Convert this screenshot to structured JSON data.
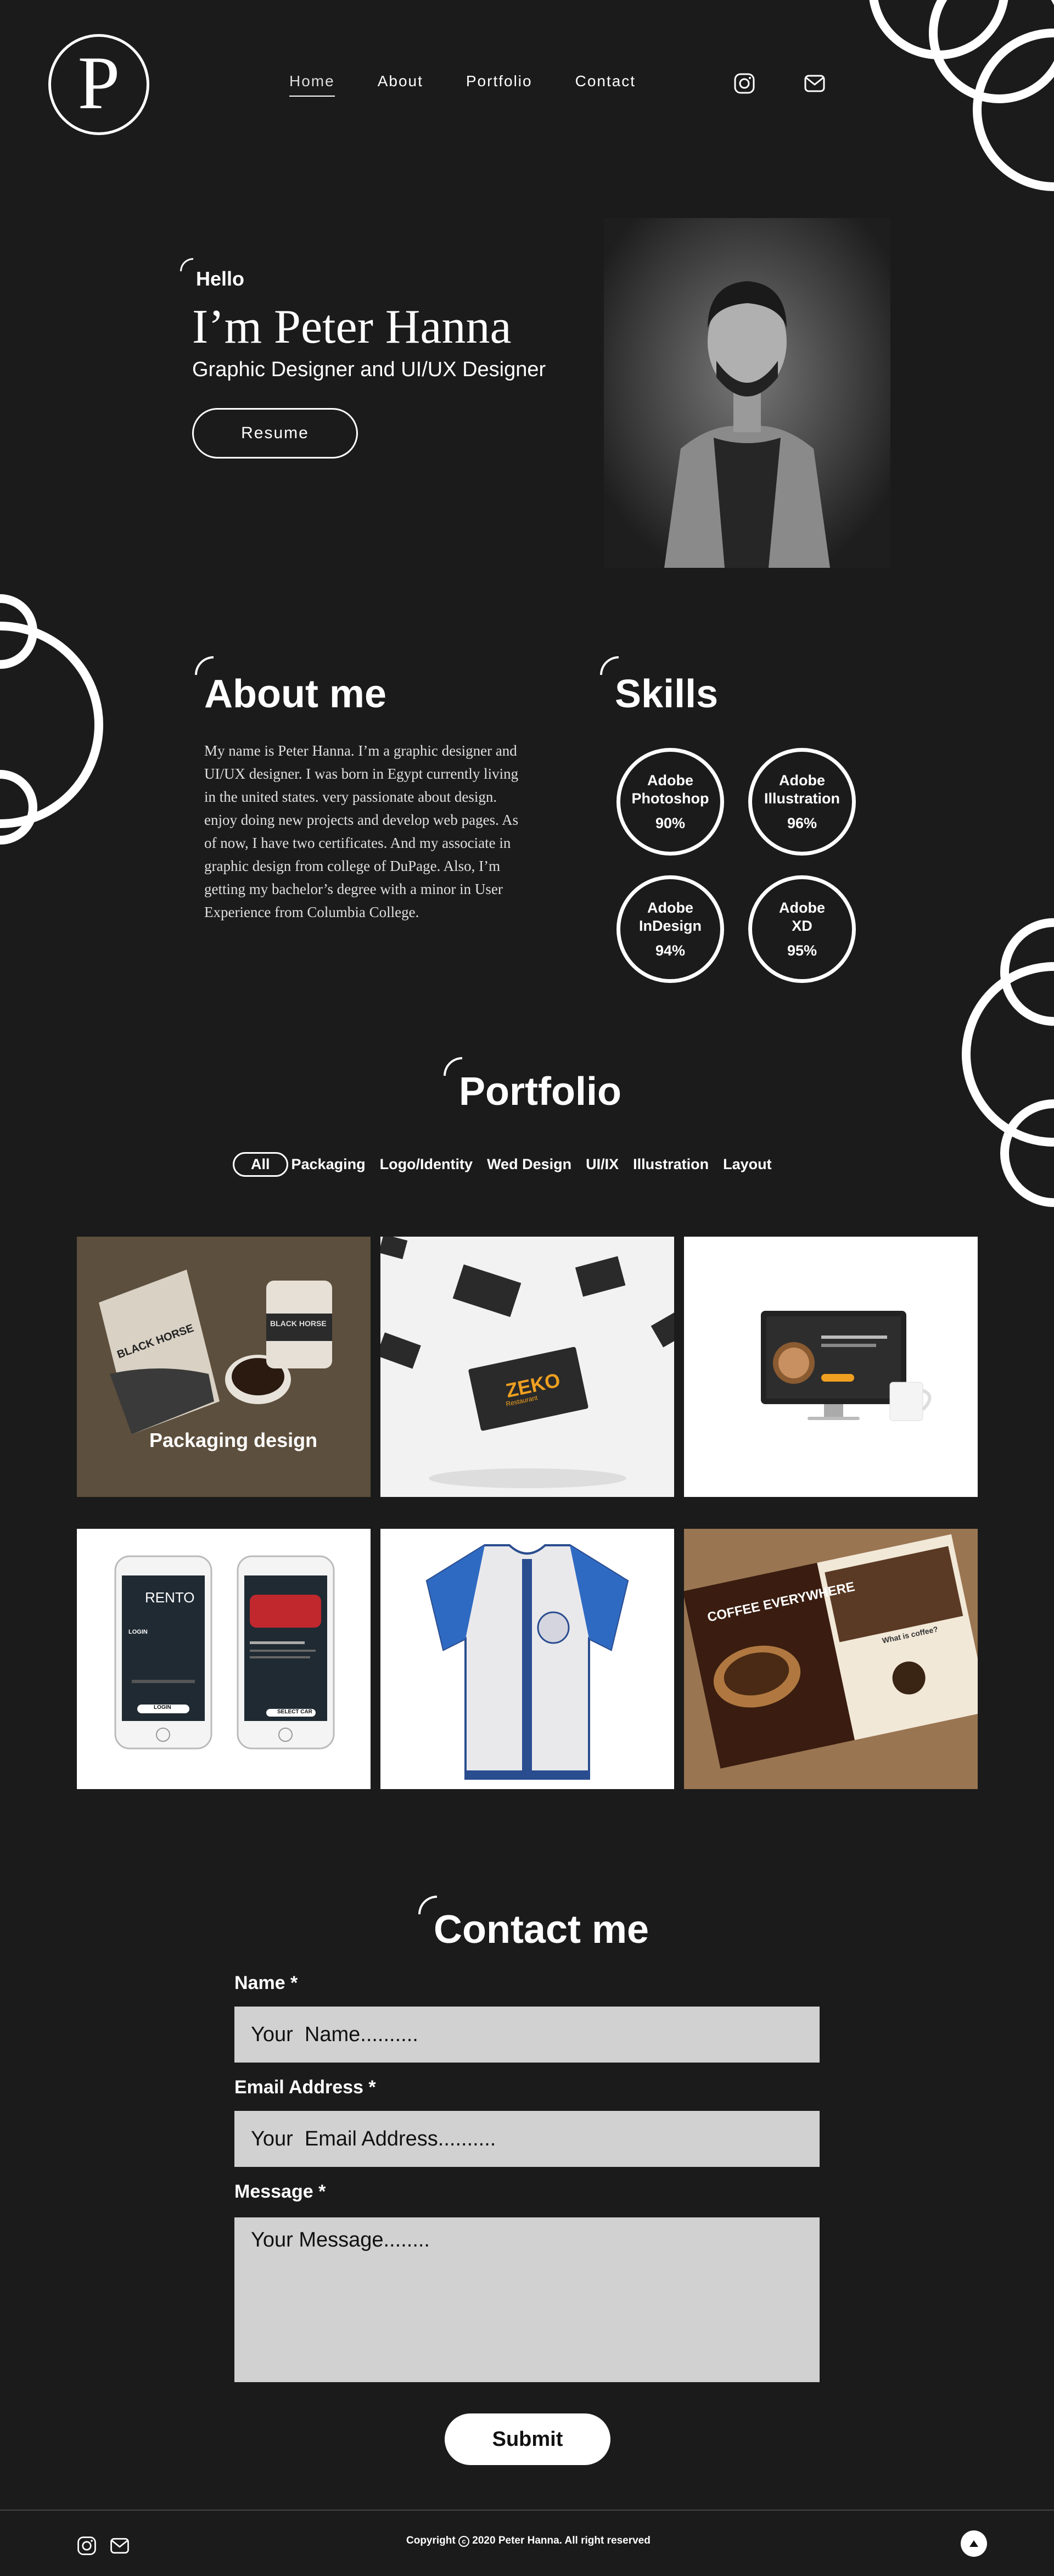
{
  "header": {
    "logo_letter": "P",
    "nav": [
      "Home",
      "About",
      "Portfolio",
      "Contact"
    ],
    "icons": [
      "instagram-icon",
      "mail-icon"
    ]
  },
  "hero": {
    "greeting": "Hello",
    "name": "I’m Peter Hanna",
    "subtitle": "Graphic Designer and UI/UX Designer",
    "resume_label": "Resume"
  },
  "about": {
    "title": "About me",
    "text": "My name is Peter Hanna. I’m a graphic designer and UI/UX designer. I was born in Egypt currently living in the united states. very passionate about design. enjoy doing new projects and develop web pages. As of now, I have two certificates. And my associate in graphic design from college of DuPage. Also, I’m getting my bachelor’s degree with a minor in User Experience from Columbia College."
  },
  "skills": {
    "title": "Skills",
    "items": [
      {
        "line1": "Adobe",
        "line2": "Photoshop",
        "pct": "90%"
      },
      {
        "line1": "Adobe",
        "line2": "Illustration",
        "pct": "96%"
      },
      {
        "line1": "Adobe",
        "line2": "InDesign",
        "pct": "94%"
      },
      {
        "line1": "Adobe",
        "line2": "XD",
        "pct": "95%"
      }
    ]
  },
  "portfolio": {
    "title": "Portfolio",
    "filters": [
      "All",
      "Packaging",
      "Logo/Identity",
      "Wed Design",
      "UI/IX",
      "Illustration",
      "Layout"
    ],
    "tiles": [
      {
        "label": "Packaging design",
        "bag_text": "BLACK HORSE",
        "cup_text": "BLACK HORSE"
      },
      {
        "card_text": "ZEKO",
        "card_sub": "Restaurant"
      },
      {},
      {
        "app_name": "RENTO",
        "login": "LOGIN",
        "select": "SELECT CAR"
      },
      {},
      {
        "headline": "COFFEE EVERYWHERE",
        "side": "What is coffee?"
      }
    ]
  },
  "contact": {
    "title": "Contact me",
    "name_label": "Name *",
    "name_placeholder": "Your  Name..........",
    "email_label": "Email Address *",
    "email_placeholder": "Your  Email Address..........",
    "message_label": "Message *",
    "message_placeholder": "Your Message........",
    "submit_label": "Submit"
  },
  "footer": {
    "copyright_prefix": "Copyright",
    "copyright_symbol": "c",
    "copyright_text": "2020 Peter Hanna. All right reserved"
  }
}
